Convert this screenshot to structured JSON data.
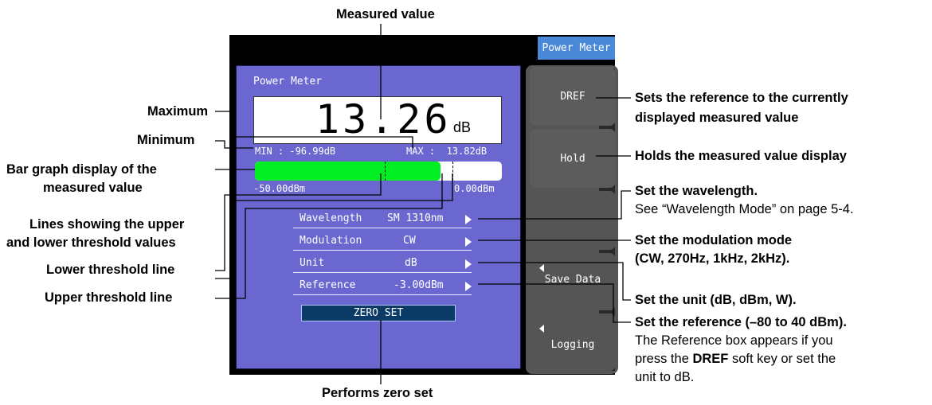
{
  "panel": {
    "title_tab": "Power Meter",
    "screen_title": "Power Meter",
    "measured_value": "13.26",
    "measured_unit": "dB",
    "min_text": "MIN : -96.99dB",
    "max_text": "MAX :  13.82dB",
    "bar": {
      "fill_fraction": 0.75,
      "lower_threshold_fraction": 0.525,
      "upper_threshold_fraction": 0.8
    },
    "bar_min_label": "-50.00dBm",
    "bar_max_label": "0.00dBm",
    "settings": [
      {
        "label": "Wavelength",
        "value": "SM 1310nm"
      },
      {
        "label": "Modulation",
        "value": "CW"
      },
      {
        "label": "Unit",
        "value": "dB"
      },
      {
        "label": "Reference",
        "value": "-3.00dBm"
      }
    ],
    "zero_set_label": "ZERO SET"
  },
  "softkeys": {
    "dref": "DREF",
    "hold": "Hold",
    "save_data": "Save Data",
    "logging": "Logging"
  },
  "callouts": {
    "measured_value": "Measured value",
    "maximum": "Maximum",
    "minimum": "Minimum",
    "bar_graph_1": "Bar graph display of the",
    "bar_graph_2": "measured value",
    "lines_1": "Lines showing the upper",
    "lines_2": "and lower threshold values",
    "lower_threshold": "Lower threshold line",
    "upper_threshold": "Upper threshold line",
    "zero_set": "Performs zero set",
    "dref_1": "Sets the reference to the currently",
    "dref_2": "displayed measured value",
    "hold": "Holds the measured value display",
    "wavelength_1": "Set the wavelength.",
    "wavelength_2": "See “Wavelength Mode” on page 5-4.",
    "modulation_1": "Set the modulation mode",
    "modulation_2": "(CW, 270Hz, 1kHz, 2kHz).",
    "unit": "Set the unit (dB, dBm, W).",
    "reference_1": "Set the reference (–80 to 40 dBm).",
    "reference_2": "The Reference box appears if you",
    "reference_3a": "press the ",
    "reference_3b": "DREF",
    "reference_3c": " soft key or set the",
    "reference_4": "unit to dB."
  }
}
